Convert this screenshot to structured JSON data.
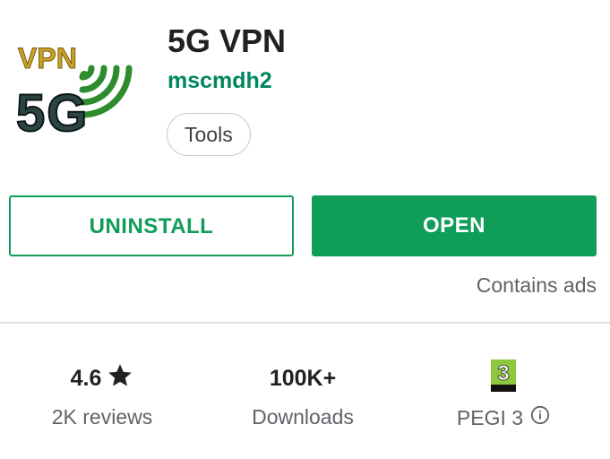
{
  "app": {
    "icon_name": "vpn-5g-app-icon",
    "icon_text_top": "VPN",
    "icon_text_bottom": "5G",
    "title": "5G VPN",
    "developer": "mscmdh2",
    "category": "Tools"
  },
  "actions": {
    "uninstall_label": "UNINSTALL",
    "open_label": "OPEN",
    "ads_note": "Contains ads"
  },
  "stats": {
    "rating_value": "4.6",
    "rating_icon": "star-icon",
    "rating_caption": "2K reviews",
    "downloads_value": "100K+",
    "downloads_caption": "Downloads",
    "pegi_badge_text": "3",
    "pegi_caption": "PEGI 3",
    "pegi_info_icon": "info-icon"
  },
  "colors": {
    "accent_green": "#0f9d58",
    "developer_green": "#01875f",
    "text_primary": "#202124",
    "text_secondary": "#5f6368",
    "pegi_green": "#8dc63f"
  }
}
